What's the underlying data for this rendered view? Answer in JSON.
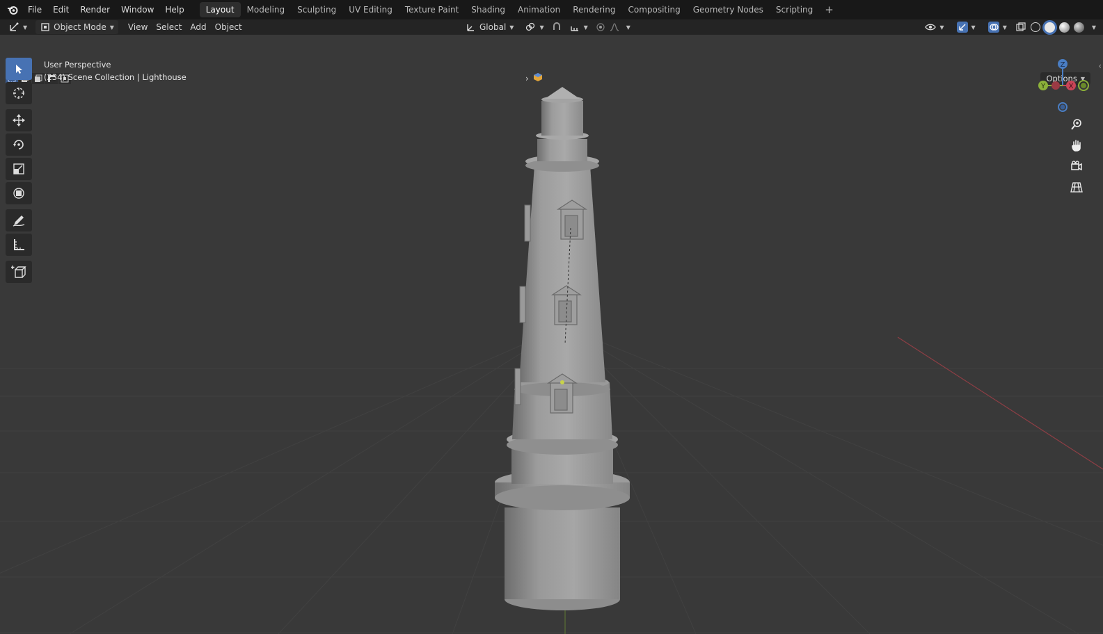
{
  "menu": [
    "File",
    "Edit",
    "Render",
    "Window",
    "Help"
  ],
  "workspaces": [
    "Layout",
    "Modeling",
    "Sculpting",
    "UV Editing",
    "Texture Paint",
    "Shading",
    "Animation",
    "Rendering",
    "Compositing",
    "Geometry Nodes",
    "Scripting"
  ],
  "workspace_add": "+",
  "header": {
    "mode": "Object Mode",
    "view": "View",
    "select": "Select",
    "add": "Add",
    "object": "Object",
    "orientation": "Global"
  },
  "viewport": {
    "perspective": "User Perspective",
    "collection": "(234) Scene Collection | Lighthouse",
    "options": "Options"
  },
  "gizmo": {
    "z": "Z",
    "y": "Y",
    "x": "X"
  },
  "colors": {
    "accent": "#4772b3",
    "x_axis": "#c94457",
    "y_axis": "#8cb13a",
    "z_axis": "#4a7ec4"
  }
}
